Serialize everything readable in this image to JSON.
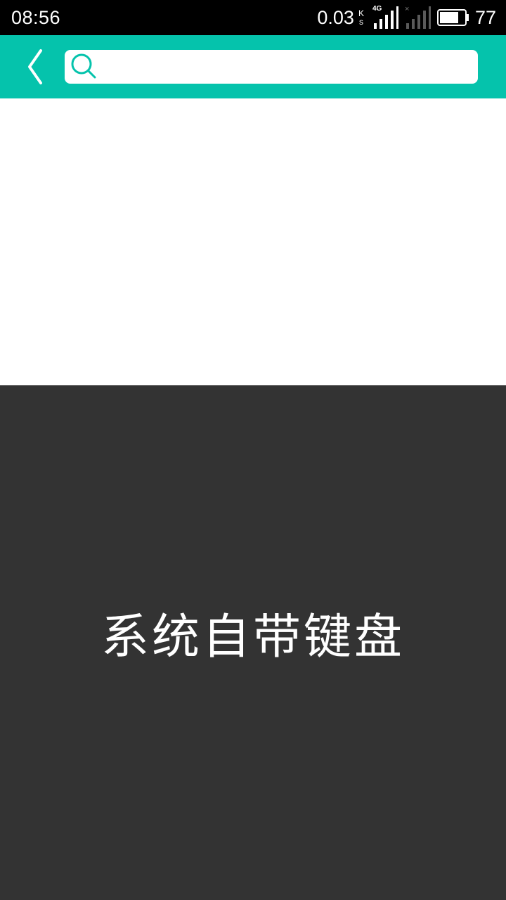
{
  "status_bar": {
    "time": "08:56",
    "net_speed": "0.03",
    "net_unit_top": "K",
    "net_unit_bottom": "s",
    "signal_label": "4G",
    "signal2_mark": "×",
    "battery_level": "77",
    "battery_fraction": 0.77
  },
  "toolbar": {
    "back_icon": "chevron-left-icon",
    "search_icon": "search-icon",
    "search_placeholder": "",
    "search_value": ""
  },
  "keyboard": {
    "label": "系统自带键盘"
  },
  "colors": {
    "accent": "#05c3ac",
    "status_bar_bg": "#000000",
    "keyboard_bg": "#333333"
  }
}
